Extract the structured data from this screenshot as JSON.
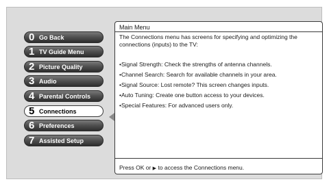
{
  "menu": {
    "items": [
      {
        "number": "0",
        "label": "Go Back"
      },
      {
        "number": "1",
        "label": "TV Guide Menu"
      },
      {
        "number": "2",
        "label": "Picture Quality"
      },
      {
        "number": "3",
        "label": "Audio"
      },
      {
        "number": "4",
        "label": "Parental Controls"
      },
      {
        "number": "5",
        "label": "Connections"
      },
      {
        "number": "6",
        "label": "Preferences"
      },
      {
        "number": "7",
        "label": "Assisted Setup"
      }
    ],
    "selected_index": 5
  },
  "panel": {
    "title": "Main Menu",
    "description": "The Connections menu has screens for specifying and optimizing the connections (inputs) to the TV:",
    "bullets": [
      "•Signal Strength: Check the strengths of antenna channels.",
      "•Channel Search: Search for available channels in your area.",
      "•Signal Source: Lost remote? This screen changes inputs.",
      "•Auto Tuning: Create one button access to your devices.",
      "•Special Features: For advanced users only."
    ],
    "footer_prefix": "Press OK or",
    "footer_arrow": "▶",
    "footer_suffix": "to access the Connections menu."
  },
  "colors": {
    "screen_bg": "#dcdcdc",
    "button_dark": "#3a3a3a",
    "button_selected": "#ffffff",
    "pointer": "#8a8a8a"
  },
  "icons": {
    "selection_pointer": "left-triangle-pointer-icon",
    "footer_arrow": "right-arrow-icon"
  }
}
